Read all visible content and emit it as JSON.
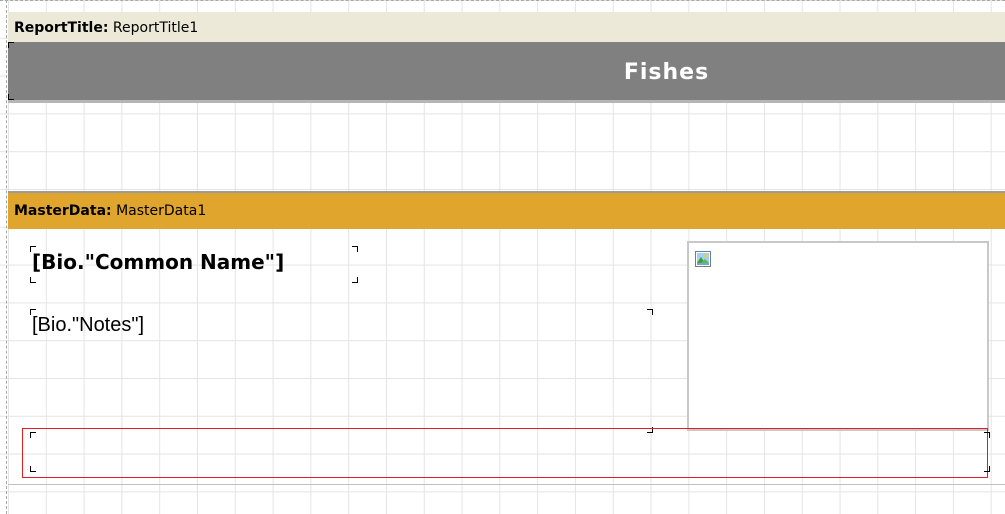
{
  "report_title_band": {
    "kind": "ReportTitle",
    "name": "ReportTitle1",
    "title_text": "Fishes",
    "title_background": "#808080"
  },
  "master_data_band": {
    "kind": "MasterData",
    "name": "MasterData1",
    "band_color": "#e0a52d",
    "common_name_field": "[Bio.\"Common Name\"]",
    "notes_field": "[Bio.\"Notes\"]",
    "picture_icon": "picture-placeholder-icon"
  },
  "colors": {
    "report_title_header": "#ece9d8",
    "selection_border": "#e02020",
    "grid": "#e4e4e4"
  }
}
